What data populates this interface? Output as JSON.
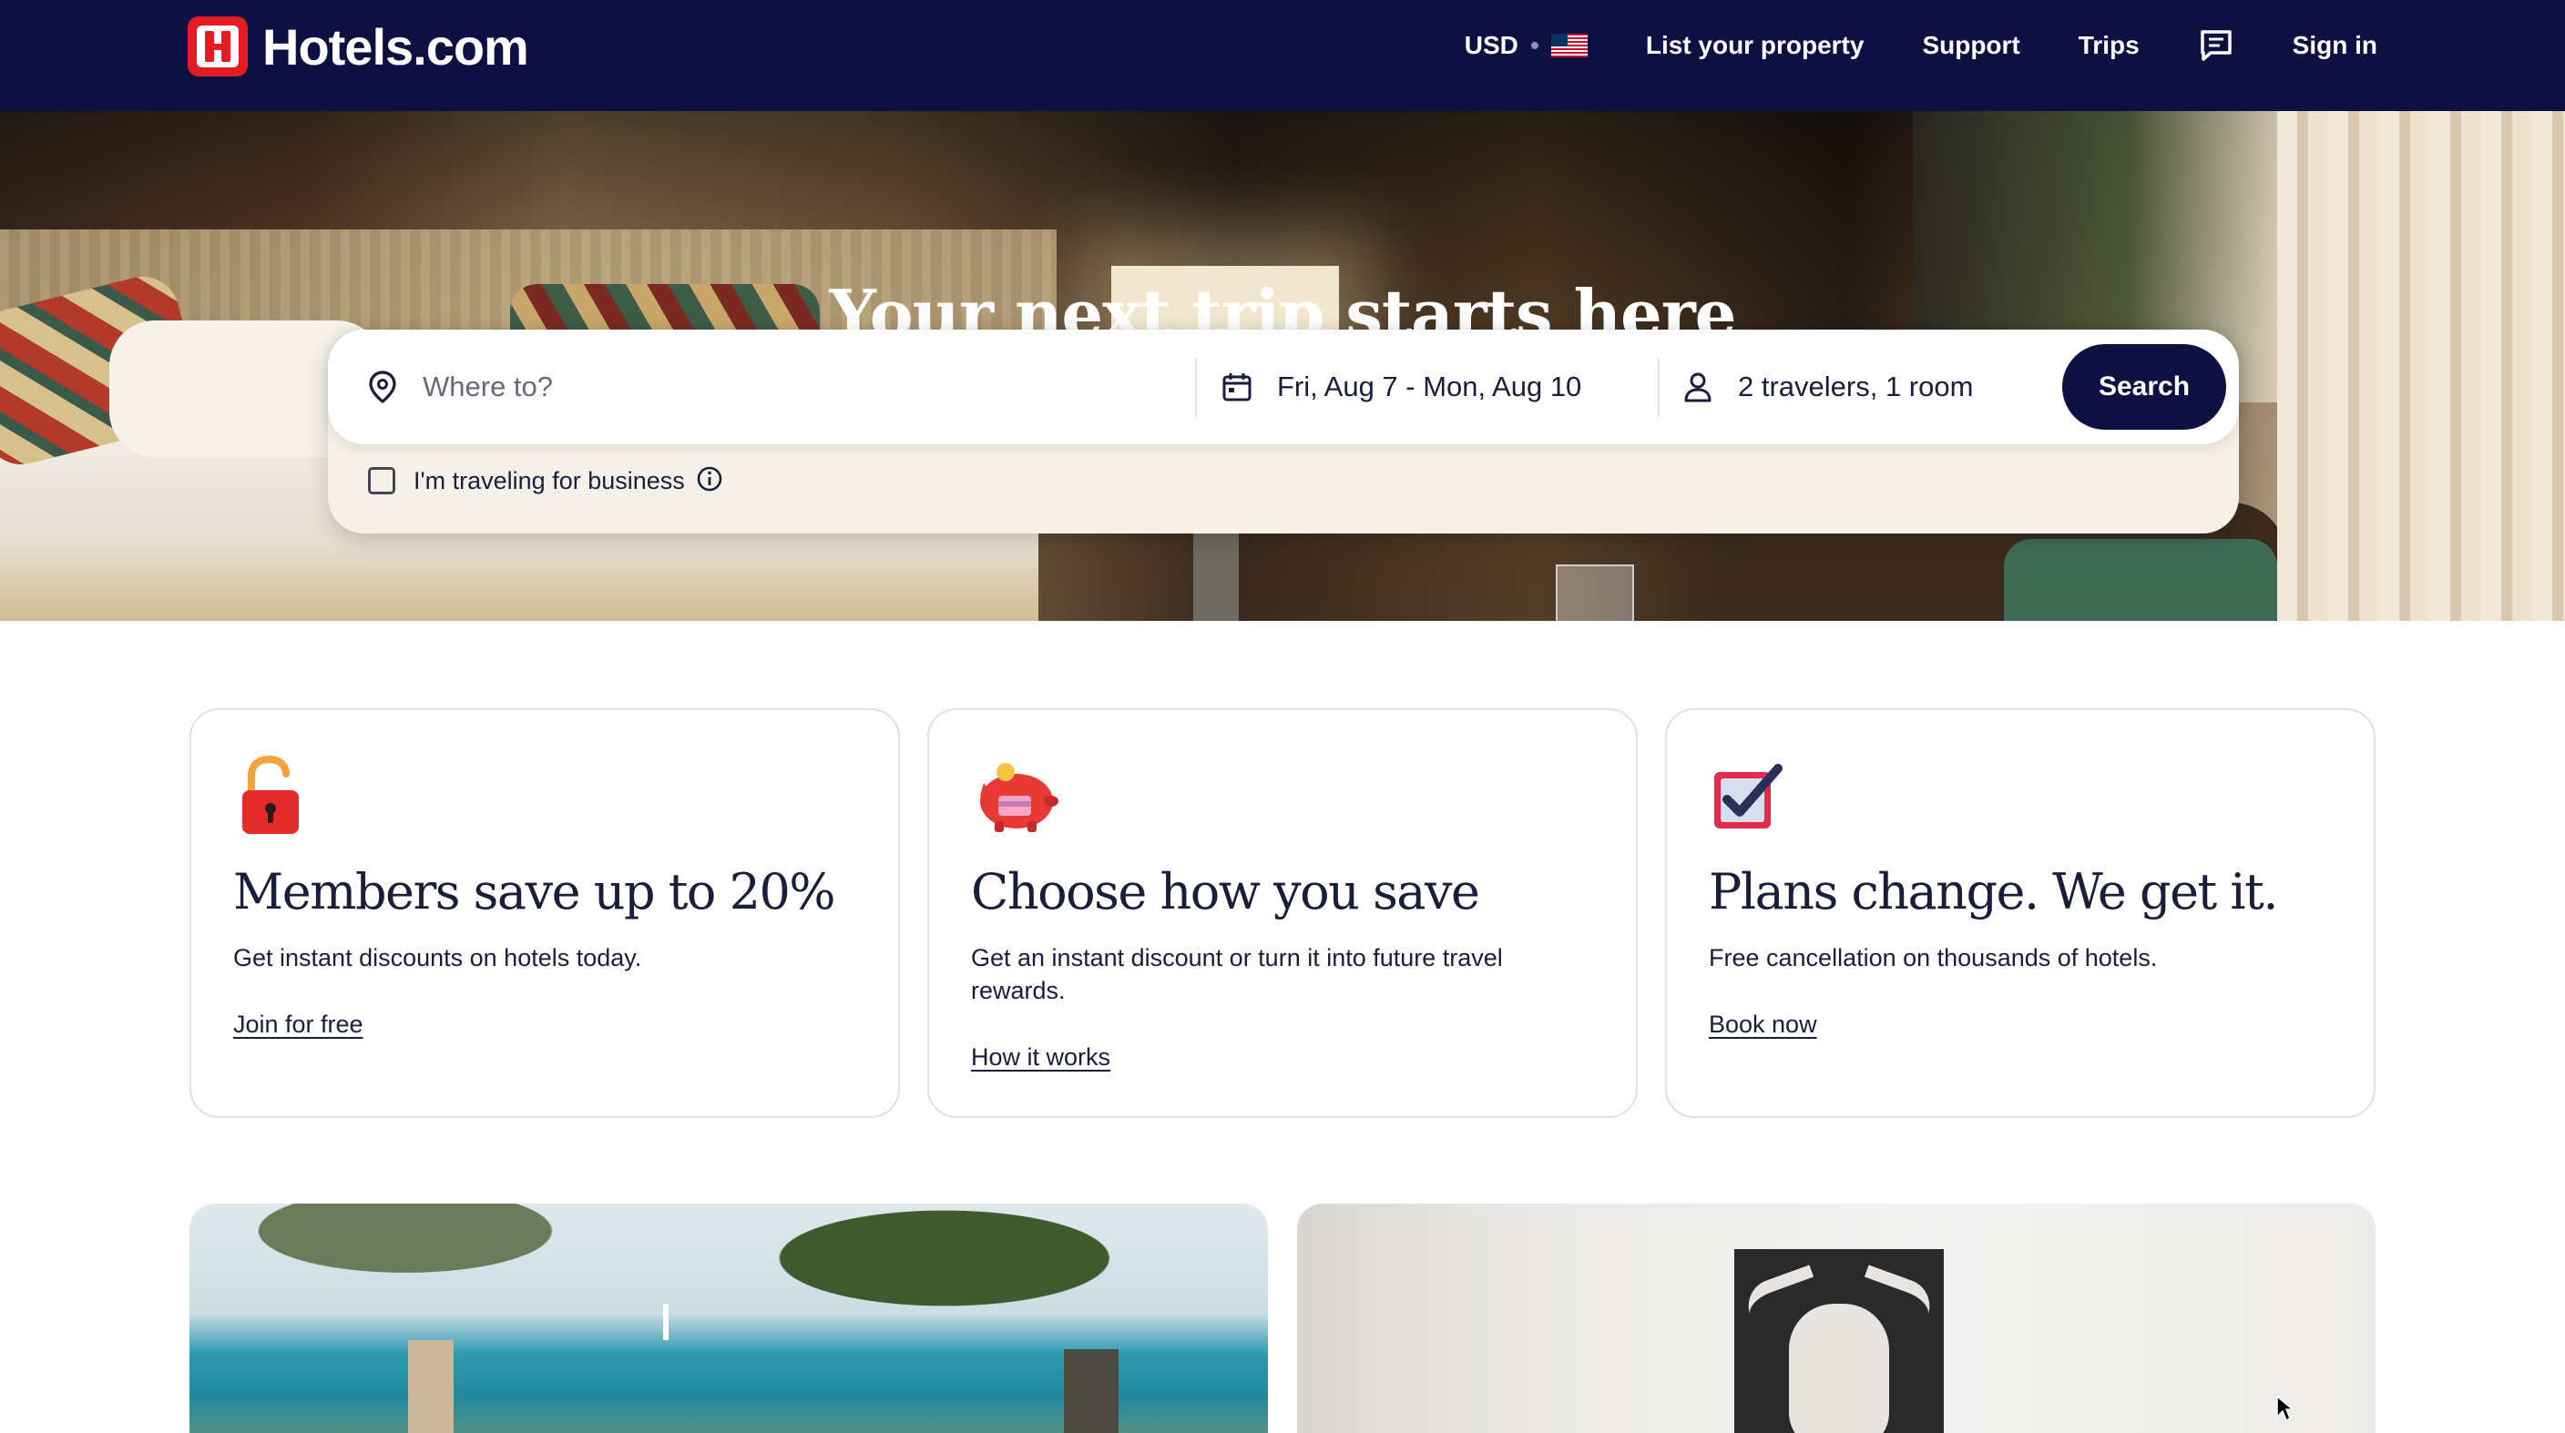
{
  "header": {
    "brand": "Hotels.com",
    "currency": "USD",
    "nav": {
      "list_property": "List your property",
      "support": "Support",
      "trips": "Trips",
      "sign_in": "Sign in"
    },
    "icons": {
      "logo": "hotels-logo-icon",
      "flag": "us-flag-icon",
      "messages": "chat-icon"
    },
    "colors": {
      "background": "#0c1142",
      "brand_red": "#e31b23"
    }
  },
  "hero": {
    "title": "Your next trip starts here"
  },
  "search": {
    "where_placeholder": "Where to?",
    "dates": "Fri, Aug 7 - Mon, Aug 10",
    "travelers": "2 travelers, 1 room",
    "button": "Search",
    "business_label": "I'm traveling for business",
    "icons": {
      "where": "location-pin-icon",
      "dates": "calendar-icon",
      "travelers": "person-icon",
      "info": "info-icon"
    }
  },
  "cards": [
    {
      "title": "Members save up to 20%",
      "desc": "Get instant discounts on hotels today.",
      "link": "Join for free",
      "icon": "unlocked-padlock-icon"
    },
    {
      "title": "Choose how you save",
      "desc": "Get an instant discount or turn it into future travel rewards.",
      "link": "How it works",
      "icon": "piggy-bank-icon"
    },
    {
      "title": "Plans change. We get it.",
      "desc": "Free cancellation on thousands of hotels.",
      "link": "Book now",
      "icon": "checkbox-checked-icon"
    }
  ],
  "promo_images": [
    {
      "name": "beach-promo-image"
    },
    {
      "name": "room-promo-image"
    }
  ]
}
